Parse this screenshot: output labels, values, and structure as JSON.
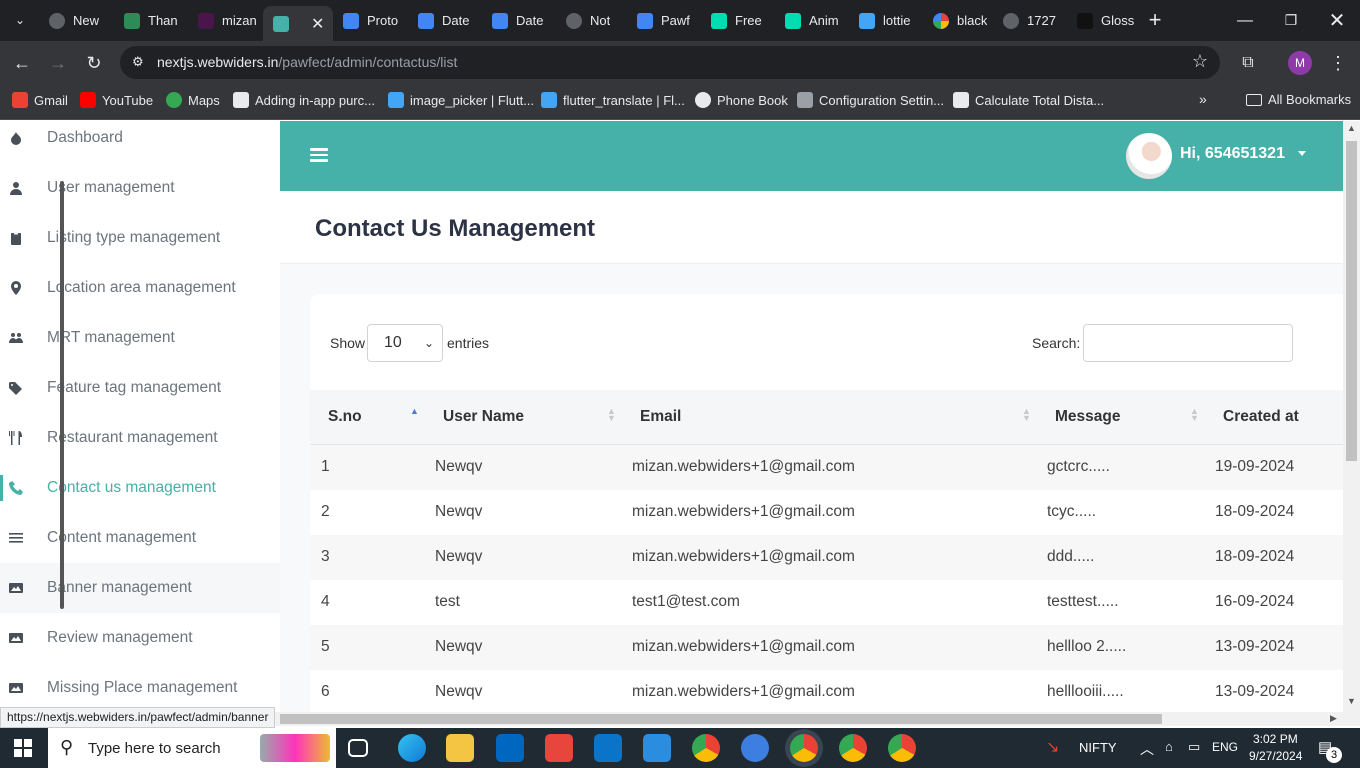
{
  "browser": {
    "tabs": [
      {
        "title": "New",
        "icon": "globe-icon"
      },
      {
        "title": "Than",
        "icon": "shield-icon"
      },
      {
        "title": "mizan",
        "icon": "slack-icon"
      },
      {
        "title": "",
        "icon": "paw-icon"
      },
      {
        "title": "Proto",
        "icon": "docs-icon"
      },
      {
        "title": "Date",
        "icon": "docs-icon"
      },
      {
        "title": "Date",
        "icon": "docs-icon"
      },
      {
        "title": "Not",
        "icon": "globe-icon"
      },
      {
        "title": "Pawf",
        "icon": "docs-icon"
      },
      {
        "title": "Free",
        "icon": "lottie-icon"
      },
      {
        "title": "Anim",
        "icon": "lottie-icon"
      },
      {
        "title": "lottie",
        "icon": "flutter-icon"
      },
      {
        "title": "black",
        "icon": "google-icon"
      },
      {
        "title": "1727",
        "icon": "globe-icon"
      },
      {
        "title": "Gloss",
        "icon": "st-icon"
      }
    ],
    "url_host": "nextjs.webwiders.in",
    "url_path": "/pawfect/admin/contactus/list",
    "profile_initial": "M",
    "bookmarks": [
      {
        "label": "Gmail",
        "icon": "gmail-icon"
      },
      {
        "label": "YouTube",
        "icon": "youtube-icon"
      },
      {
        "label": "Maps",
        "icon": "maps-icon"
      },
      {
        "label": "Adding in-app purc...",
        "icon": "bookmark-icon"
      },
      {
        "label": "image_picker | Flutt...",
        "icon": "flutter-icon"
      },
      {
        "label": "flutter_translate | Fl...",
        "icon": "flutter-icon"
      },
      {
        "label": "Phone Book",
        "icon": "globe-icon"
      },
      {
        "label": "Configuration Settin...",
        "icon": "doc-icon"
      },
      {
        "label": "Calculate Total Dista...",
        "icon": "bookmark-icon"
      }
    ],
    "all_bookmarks": "All Bookmarks",
    "status_url": "https://nextjs.webwiders.in/pawfect/admin/banner"
  },
  "sidebar": {
    "items": [
      {
        "label": "Dashboard",
        "icon": "dashboard-icon",
        "active": false
      },
      {
        "label": "User management",
        "icon": "user-icon",
        "active": false
      },
      {
        "label": "Listing type management",
        "icon": "clipboard-icon",
        "active": false
      },
      {
        "label": "Location area management",
        "icon": "location-pin-icon",
        "active": false
      },
      {
        "label": "MRT management",
        "icon": "users-icon",
        "active": false
      },
      {
        "label": "Feature tag management",
        "icon": "tags-icon",
        "active": false
      },
      {
        "label": "Restaurant management",
        "icon": "utensils-icon",
        "active": false
      },
      {
        "label": "Contact us management",
        "icon": "phone-icon",
        "active": true
      },
      {
        "label": "Content management",
        "icon": "list-icon",
        "active": false
      },
      {
        "label": "Banner management",
        "icon": "image-icon",
        "active": false
      },
      {
        "label": "Review management",
        "icon": "image-icon",
        "active": false
      },
      {
        "label": "Missing Place management",
        "icon": "image-icon",
        "active": false
      }
    ]
  },
  "header": {
    "greeting": "Hi, 654651321"
  },
  "main": {
    "title": "Contact Us Management",
    "length": {
      "show": "Show",
      "value": "10",
      "entries": "entries"
    },
    "search": {
      "label": "Search:",
      "value": ""
    },
    "columns": [
      "S.no",
      "User Name",
      "Email",
      "Message",
      "Created at"
    ],
    "rows": [
      {
        "sno": "1",
        "name": "Newqv",
        "email": "mizan.webwiders+1@gmail.com",
        "message": "gctcrc.....",
        "created": "19-09-2024"
      },
      {
        "sno": "2",
        "name": "Newqv",
        "email": "mizan.webwiders+1@gmail.com",
        "message": "tcyc.....",
        "created": "18-09-2024"
      },
      {
        "sno": "3",
        "name": "Newqv",
        "email": "mizan.webwiders+1@gmail.com",
        "message": "ddd.....",
        "created": "18-09-2024"
      },
      {
        "sno": "4",
        "name": "test",
        "email": "test1@test.com",
        "message": "testtest.....",
        "created": "16-09-2024"
      },
      {
        "sno": "5",
        "name": "Newqv",
        "email": "mizan.webwiders+1@gmail.com",
        "message": "hellloo 2.....",
        "created": "13-09-2024"
      },
      {
        "sno": "6",
        "name": "Newqv",
        "email": "mizan.webwiders+1@gmail.com",
        "message": "helllooiii.....",
        "created": "13-09-2024"
      }
    ]
  },
  "taskbar": {
    "search_placeholder": "Type here to search",
    "nifty": "NIFTY",
    "lang": "ENG",
    "time": "3:02 PM",
    "date": "9/27/2024",
    "notifications": "3"
  },
  "colors": {
    "accent": "#45b1a8"
  }
}
